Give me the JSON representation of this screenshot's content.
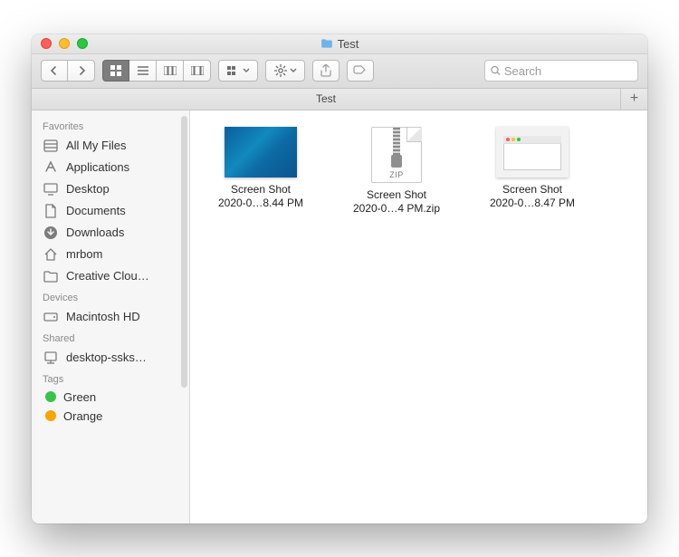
{
  "window": {
    "title": "Test"
  },
  "toolbar": {
    "search_placeholder": "Search"
  },
  "pathbar": {
    "label": "Test"
  },
  "sidebar": {
    "sections": [
      {
        "header": "Favorites",
        "items": [
          {
            "icon": "all-my-files-icon",
            "label": "All My Files"
          },
          {
            "icon": "applications-icon",
            "label": "Applications"
          },
          {
            "icon": "desktop-icon",
            "label": "Desktop"
          },
          {
            "icon": "documents-icon",
            "label": "Documents"
          },
          {
            "icon": "downloads-icon",
            "label": "Downloads"
          },
          {
            "icon": "home-icon",
            "label": "mrbom"
          },
          {
            "icon": "folder-icon",
            "label": "Creative Clou…"
          }
        ]
      },
      {
        "header": "Devices",
        "items": [
          {
            "icon": "harddisk-icon",
            "label": "Macintosh HD"
          }
        ]
      },
      {
        "header": "Shared",
        "items": [
          {
            "icon": "network-pc-icon",
            "label": "desktop-ssks…"
          }
        ]
      },
      {
        "header": "Tags",
        "items": [
          {
            "icon": "tag-dot",
            "color": "#3ac24a",
            "label": "Green"
          },
          {
            "icon": "tag-dot",
            "color": "#f7a500",
            "label": "Orange"
          }
        ]
      }
    ]
  },
  "files": [
    {
      "kind": "screenshot",
      "line1": "Screen Shot",
      "line2": "2020-0…8.44 PM",
      "thumb_variant": "full"
    },
    {
      "kind": "zip",
      "line1": "Screen Shot",
      "line2": "2020-0…4 PM.zip",
      "zip_badge": "ZIP"
    },
    {
      "kind": "screenshot",
      "line1": "Screen Shot",
      "line2": "2020-0…8.47 PM",
      "thumb_variant": "windowed"
    }
  ]
}
